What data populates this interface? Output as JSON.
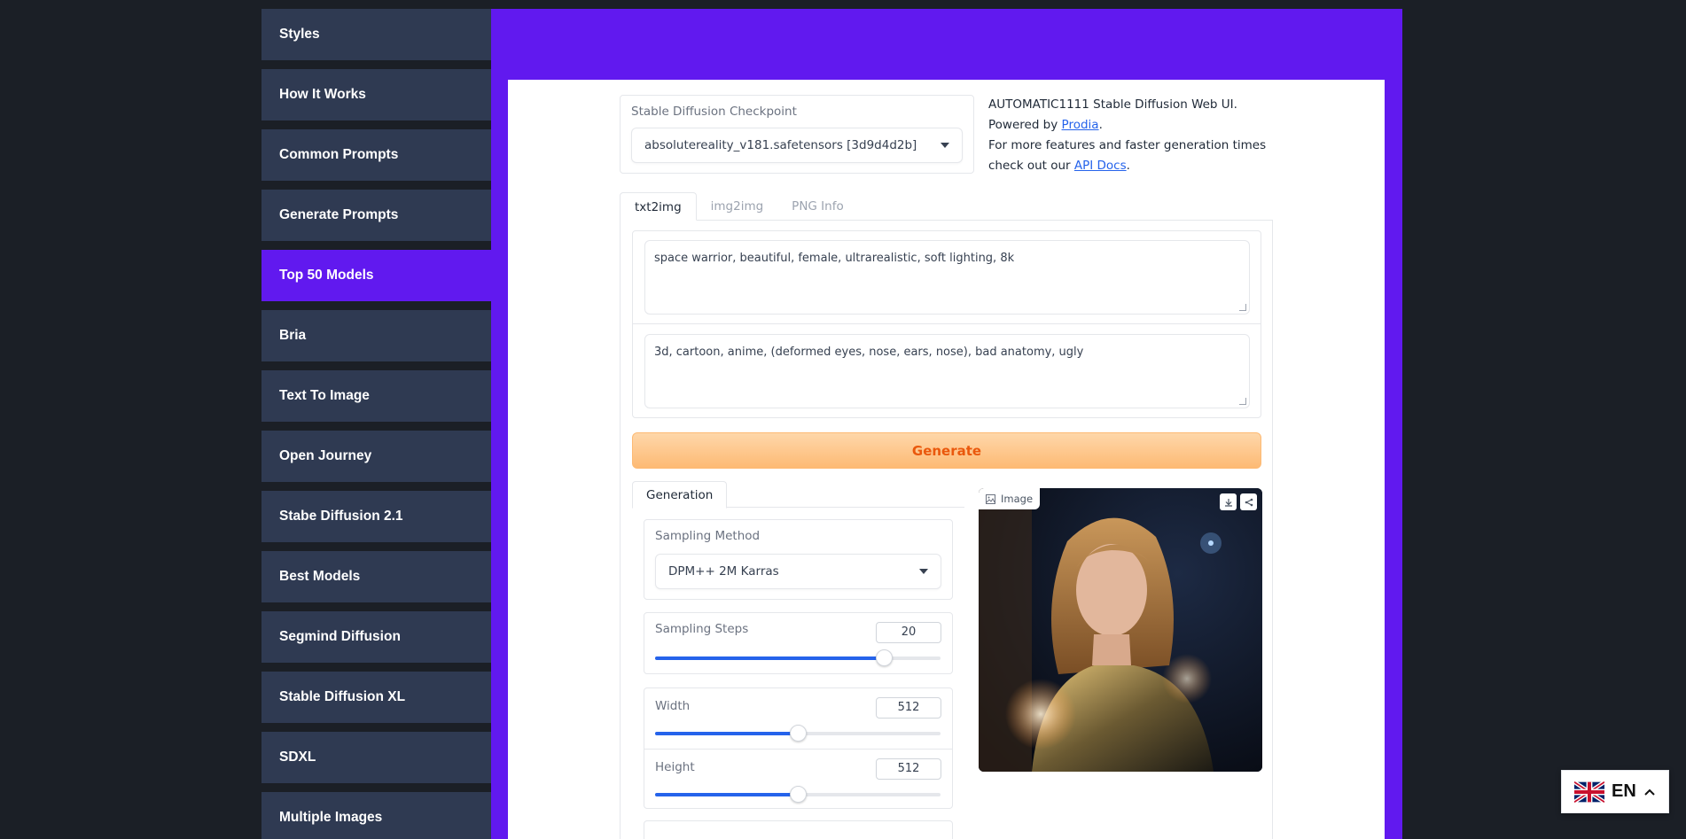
{
  "sidebar": {
    "items": [
      {
        "label": "Styles"
      },
      {
        "label": "How It Works"
      },
      {
        "label": "Common Prompts"
      },
      {
        "label": "Generate Prompts"
      },
      {
        "label": "Top 50 Models",
        "active": true
      },
      {
        "label": "Bria"
      },
      {
        "label": "Text To Image"
      },
      {
        "label": "Open Journey"
      },
      {
        "label": "Stabe Diffusion 2.1"
      },
      {
        "label": "Best Models"
      },
      {
        "label": "Segmind Diffusion"
      },
      {
        "label": "Stable Diffusion XL"
      },
      {
        "label": "SDXL"
      },
      {
        "label": "Multiple Images"
      }
    ]
  },
  "checkpoint": {
    "label": "Stable Diffusion Checkpoint",
    "value": "absolutereality_v181.safetensors [3d9d4d2b]"
  },
  "info": {
    "line1": "AUTOMATIC1111 Stable Diffusion Web UI.",
    "powered_prefix": "Powered by ",
    "powered_link": "Prodia",
    "powered_suffix": ".",
    "more_prefix": "For more features and faster generation times check out our ",
    "more_link": "API Docs",
    "more_suffix": "."
  },
  "tabs": [
    "txt2img",
    "img2img",
    "PNG Info"
  ],
  "prompt": "space warrior, beautiful, female, ultrarealistic, soft lighting, 8k",
  "negative_prompt": "3d, cartoon, anime, (deformed eyes, nose, ears, nose), bad anatomy, ugly",
  "generate_label": "Generate",
  "generation_tab": "Generation",
  "sampling": {
    "label": "Sampling Method",
    "value": "DPM++ 2M Karras"
  },
  "steps": {
    "label": "Sampling Steps",
    "value": "20",
    "fraction": 0.8
  },
  "width": {
    "label": "Width",
    "value": "512",
    "fraction": 0.5
  },
  "height": {
    "label": "Height",
    "value": "512",
    "fraction": 0.5
  },
  "image": {
    "label": "Image"
  },
  "language": {
    "code": "EN"
  },
  "colors": {
    "accent": "#6119ef",
    "sidebar": "#2f3a52",
    "generate": "#fdba74"
  }
}
